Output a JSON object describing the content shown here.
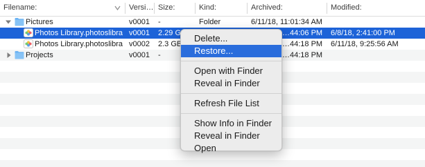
{
  "columns": [
    "Filename:",
    "Versi…",
    "Size:",
    "Kind:",
    "Archived:",
    "Modified:"
  ],
  "rows": [
    {
      "name": "Pictures",
      "version": "v0001",
      "size": "-",
      "kind": "Folder",
      "archived": "6/11/18, 11:01:34 AM",
      "modified": ""
    },
    {
      "name": "Photos Library.photoslibra",
      "version": "v0001",
      "size": "2.29 GB",
      "kind": "",
      "archived": "…44:06 PM",
      "modified": "6/8/18, 2:41:00 PM"
    },
    {
      "name": "Photos Library.photoslibra",
      "version": "v0002",
      "size": "2.3 GB",
      "kind": "",
      "archived": "…44:18 PM",
      "modified": "6/11/18, 9:25:56 AM"
    },
    {
      "name": "Projects",
      "version": "v0001",
      "size": "-",
      "kind": "",
      "archived": "…44:18 PM",
      "modified": ""
    }
  ],
  "context_menu": {
    "items": [
      "Delete...",
      "Restore...",
      "Open with Finder",
      "Reveal in Finder",
      "Refresh File List",
      "Show Info in Finder",
      "Reveal in Finder",
      "Open"
    ],
    "highlighted": "Restore..."
  },
  "colors": {
    "selection": "#1d63d8",
    "menu_highlight": "#2a6ddc",
    "folder": "#6cb3f3"
  },
  "icons": {
    "folder": "folder-icon",
    "photos_library": "photos-library-icon",
    "disclosure_open": "disclosure-down-icon",
    "disclosure_closed": "disclosure-right-icon",
    "sort": "sort-descending-icon"
  }
}
